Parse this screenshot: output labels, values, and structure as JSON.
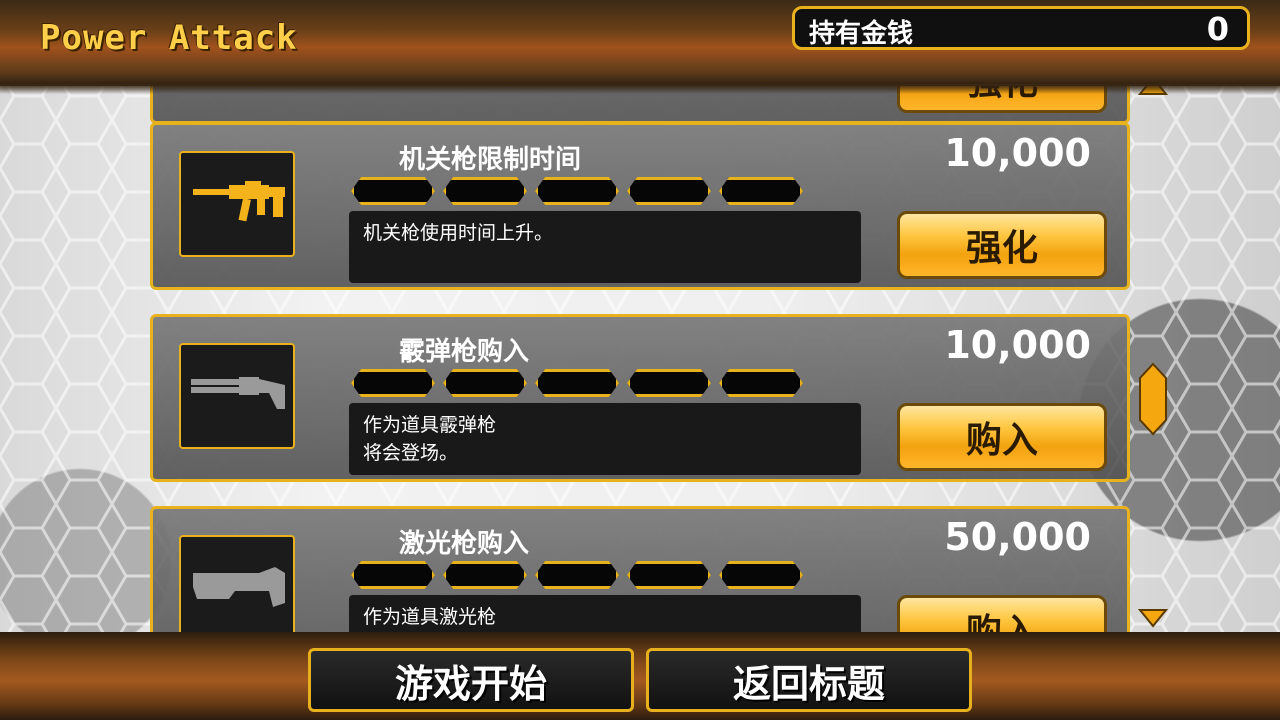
{
  "header": {
    "title": "Power Attack",
    "money_label": "持有金钱",
    "money_value": "0"
  },
  "top_card": {
    "action": "强化"
  },
  "items": [
    {
      "name": "机关枪限制时间",
      "price": "10,000",
      "description": "机关枪使用时间上升。",
      "action": "强化",
      "icon": "machine-gun-icon",
      "icon_color": "#f4b21b"
    },
    {
      "name": "霰弹枪购入",
      "price": "10,000",
      "description": "作为道具霰弹枪\n将会登场。",
      "action": "购入",
      "icon": "shotgun-icon",
      "icon_color": "#9a9a9a"
    },
    {
      "name": "激光枪购入",
      "price": "50,000",
      "description": "作为道具激光枪",
      "action": "购入",
      "icon": "laser-gun-icon",
      "icon_color": "#9a9a9a"
    }
  ],
  "footer": {
    "start_label": "游戏开始",
    "back_label": "返回标题"
  },
  "colors": {
    "accent": "#e8b21c",
    "button": "#ffc640"
  }
}
